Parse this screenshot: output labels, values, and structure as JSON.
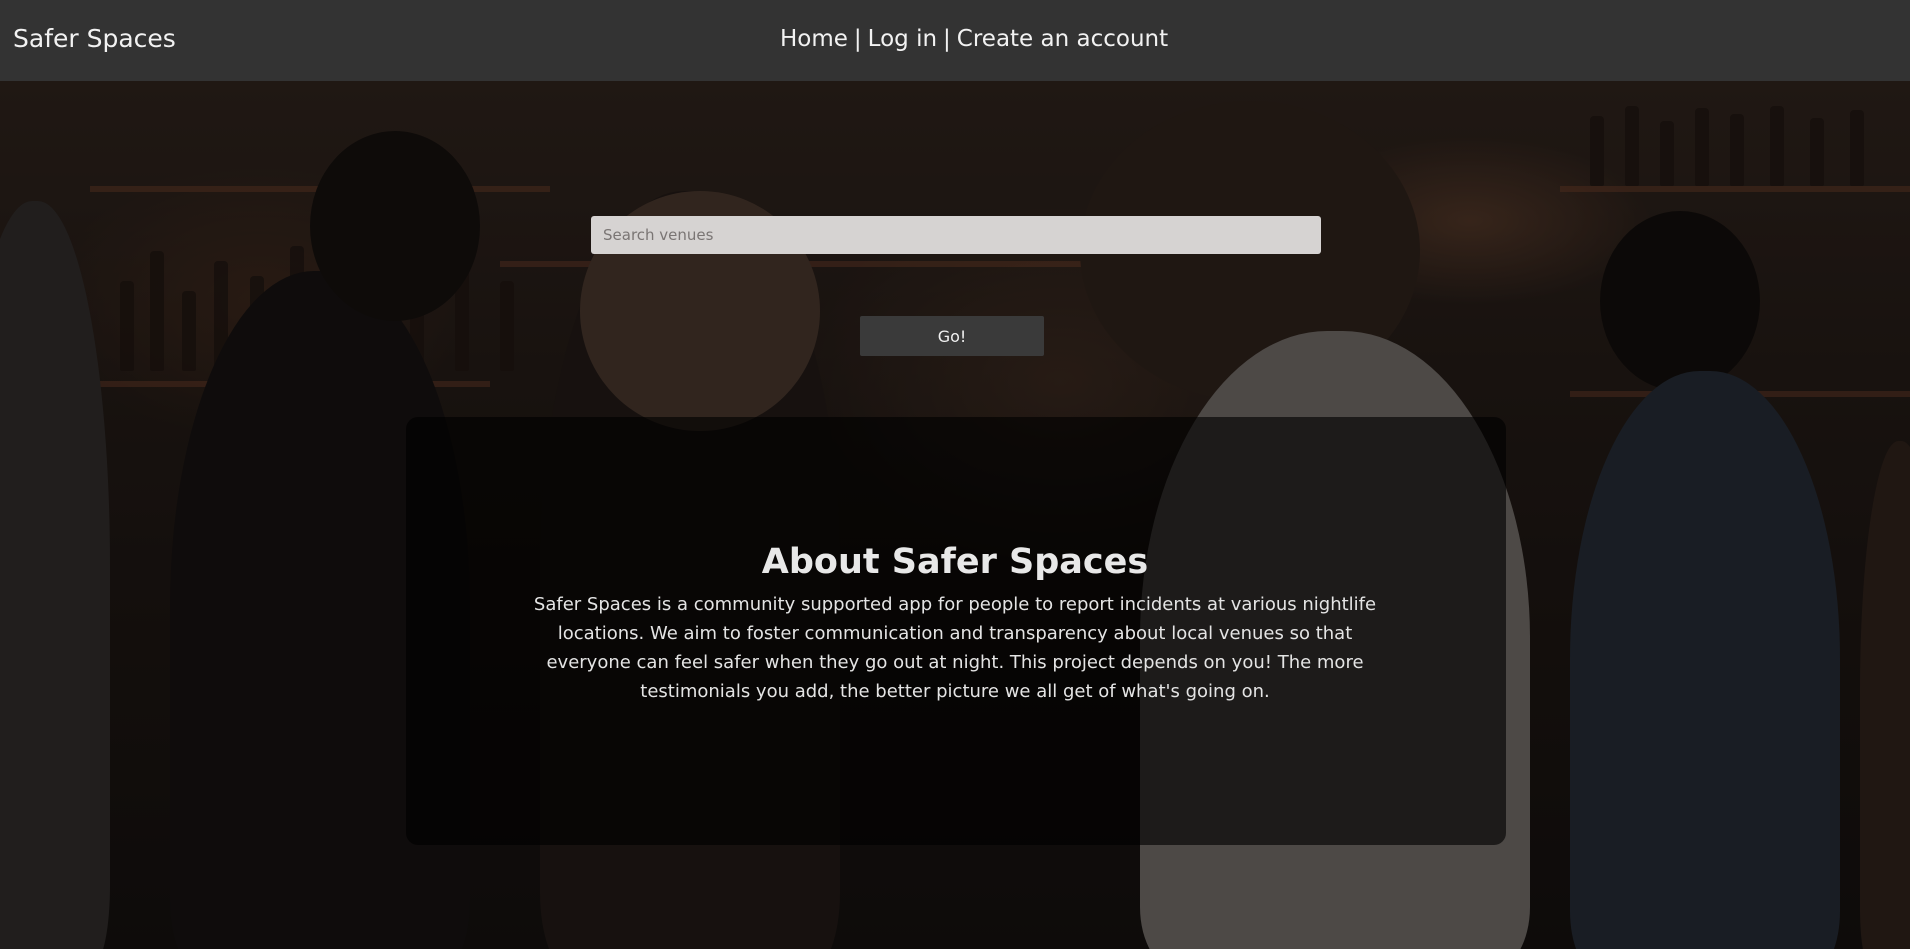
{
  "navbar": {
    "brand": "Safer Spaces",
    "links": [
      {
        "label": "Home"
      },
      {
        "label": "Log in"
      },
      {
        "label": "Create an account"
      }
    ],
    "separator": "|",
    "background": "#333333"
  },
  "search": {
    "placeholder": "Search venues",
    "value": "",
    "button_label": "Go!"
  },
  "about": {
    "title": "About Safer Spaces",
    "body": "Safer Spaces is a community supported app for people to report incidents at various nightlife locations. We aim to foster communication and transparency about local venues so that everyone can feel safer when they go out at night. This project depends on you! The more testimonials you add, the better picture we all get of what's going on."
  },
  "colors": {
    "navbar": "#333333",
    "panel": "rgba(0,0,0,0.62)",
    "text": "#f2f2f2"
  }
}
